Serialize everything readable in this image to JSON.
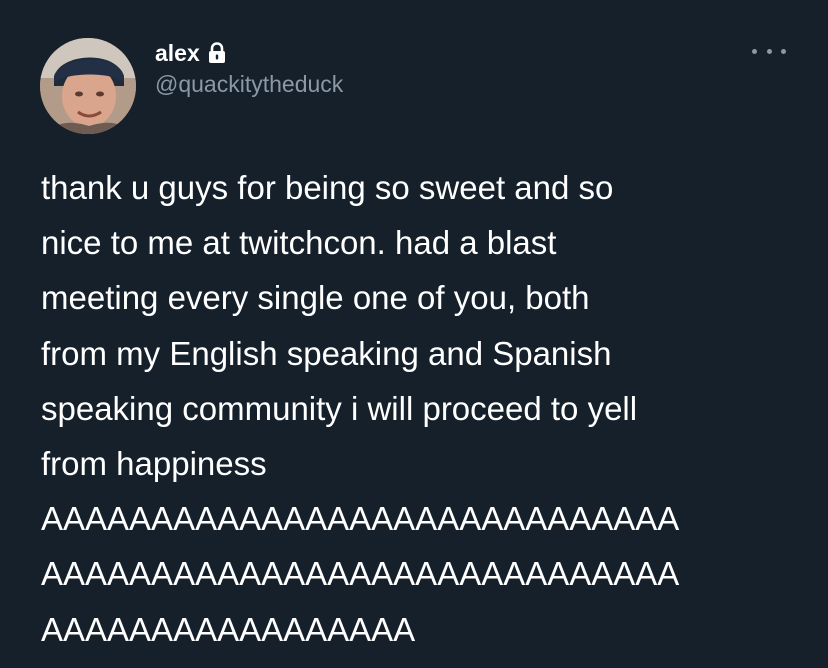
{
  "author": {
    "display_name": "alex",
    "handle": "@quackitytheduck",
    "protected_icon": "lock-icon",
    "avatar_icon": "profile-photo"
  },
  "menu": {
    "icon": "more-options-icon"
  },
  "tweet": {
    "text": "thank u guys for being so sweet and so\nnice to me at twitchcon. had a blast\nmeeting every single one of you, both\nfrom my English speaking and Spanish\nspeaking community i will proceed to yell\nfrom happiness\nAAAAAAAAAAAAAAAAAAAAAAAAAAAAA\nAAAAAAAAAAAAAAAAAAAAAAAAAAAAA\nAAAAAAAAAAAAAAAAA"
  },
  "colors": {
    "background": "#15202b",
    "primary_text": "#ffffff",
    "secondary_text": "#8b98a5"
  }
}
